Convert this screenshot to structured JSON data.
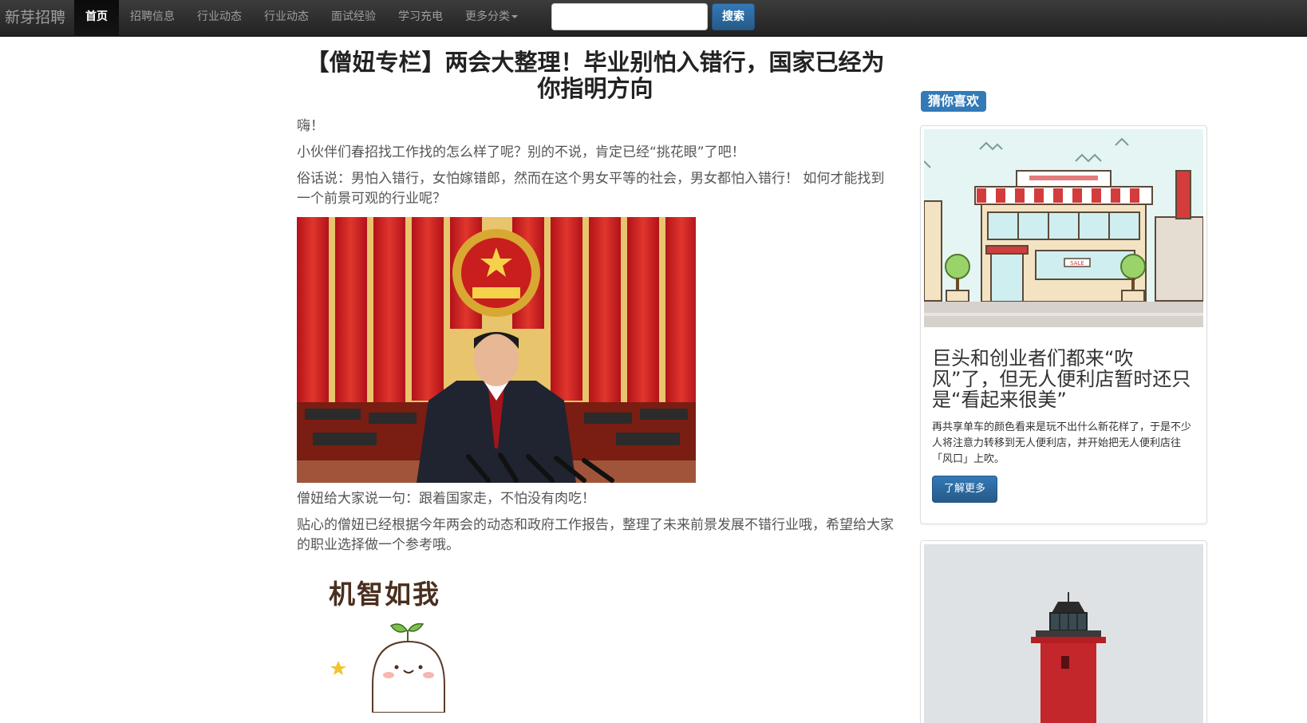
{
  "navbar": {
    "brand": "新芽招聘",
    "items": [
      {
        "label": "首页",
        "active": true
      },
      {
        "label": "招聘信息"
      },
      {
        "label": "行业动态"
      },
      {
        "label": "行业动态"
      },
      {
        "label": "面试经验"
      },
      {
        "label": "学习充电"
      },
      {
        "label": "更多分类"
      }
    ],
    "search": {
      "value": "",
      "placeholder": "",
      "button_label": "搜索"
    }
  },
  "article": {
    "title": "【僧妞专栏】两会大整理！毕业别怕入错行，国家已经为你指明方向",
    "paragraphs": [
      "嗨！",
      "小伙伴们春招找工作找的怎么样了呢？别的不说，肯定已经“挑花眼”了吧！",
      "俗话说：男怕入错行，女怕嫁错郎，然而在这个男女平等的社会，男女都怕入错行！ 如何才能找到一个前景可观的行业呢？",
      "僧妞给大家说一句：跟着国家走，不怕没有肉吃！",
      "贴心的僧妞已经根据今年两会的动态和政府工作报告，整理了未来前景发展不错行业哦，希望给大家的职业选择做一个参考哦。"
    ],
    "sticker_text": "机智如我"
  },
  "sidebar": {
    "heading": "猜你喜欢",
    "cards": [
      {
        "title": "巨头和创业者们都来“吹风”了，但无人便利店暂时还只是“看起来很美”",
        "description": "再共享单车的颜色看来是玩不出什么新花样了，于是不少人将注意力转移到无人便利店，并开始把无人便利店往「风口」上吹。",
        "button_label": "了解更多",
        "shop_sign": "SALE"
      }
    ]
  },
  "colors": {
    "accent": "#337ab7",
    "navbar": "#222222",
    "text_muted": "#555555"
  }
}
